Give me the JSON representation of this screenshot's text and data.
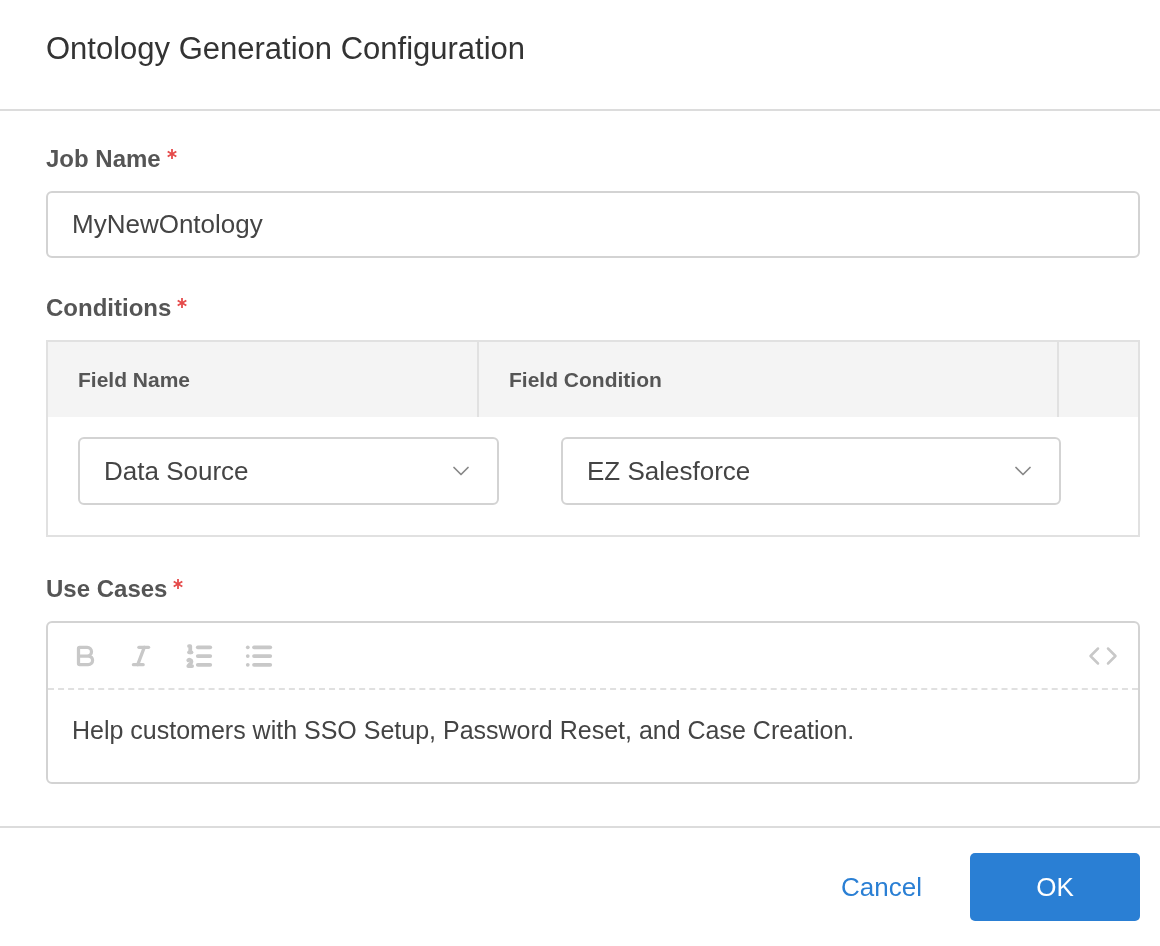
{
  "dialog": {
    "title": "Ontology Generation Configuration"
  },
  "job_name": {
    "label": "Job Name",
    "required": true,
    "value": "MyNewOntology"
  },
  "conditions": {
    "label": "Conditions",
    "required": true,
    "columns": [
      "Field Name",
      "Field Condition"
    ],
    "rows": [
      {
        "field_name": "Data Source",
        "field_condition": "EZ Salesforce"
      }
    ]
  },
  "use_cases": {
    "label": "Use Cases",
    "required": true,
    "value": "Help customers with SSO Setup, Password Reset, and Case Creation."
  },
  "buttons": [
    {
      "label": "Cancel",
      "kind": "link"
    },
    {
      "label": "OK",
      "kind": "primary"
    }
  ]
}
